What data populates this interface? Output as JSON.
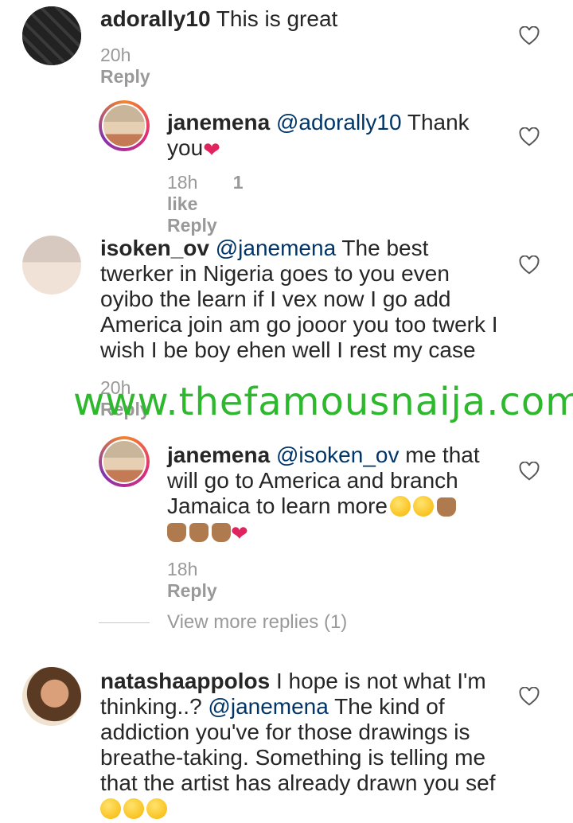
{
  "comments": [
    {
      "username": "adorally10",
      "text": " This is great",
      "time": "20h",
      "reply_label": "Reply"
    },
    {
      "username": "janemena",
      "mention": "@adorally10",
      "text_after": " Thank you",
      "time": "18h",
      "likes": "1 like",
      "reply_label": "Reply"
    },
    {
      "username": "isoken_ov",
      "mention": "@janemena",
      "text_after": " The best twerker in Nigeria goes to you even oyibo the learn if I vex now I go add America join am go jooor you too twerk I wish I be boy ehen well I rest my case",
      "time": "20h",
      "reply_label": "Reply"
    },
    {
      "username": "janemena",
      "mention": "@isoken_ov",
      "text_after": " me that will go to America and branch Jamaica to learn more",
      "time": "18h",
      "reply_label": "Reply"
    },
    {
      "username": "natashaappolos",
      "text_before": " I hope is not what I'm thinking..? ",
      "mention": "@janemena",
      "text_after": " The kind of addiction you've for those drawings is breathe-taking. Something is telling me that the artist has already drawn you sef"
    }
  ],
  "view_more": "View more replies (1)",
  "watermark": "www.thefamousnaija.com",
  "icons": {
    "like": "heart-outline-icon",
    "love": "red-heart-emoji",
    "rofl": "laughing-face-emoji",
    "hands": "raising-hands-emoji",
    "kiss": "kissing-face-emoji"
  },
  "colors": {
    "mention": "#003569",
    "meta": "#999999",
    "watermark": "#2db82d",
    "heart_emoji": "#e0245e"
  }
}
